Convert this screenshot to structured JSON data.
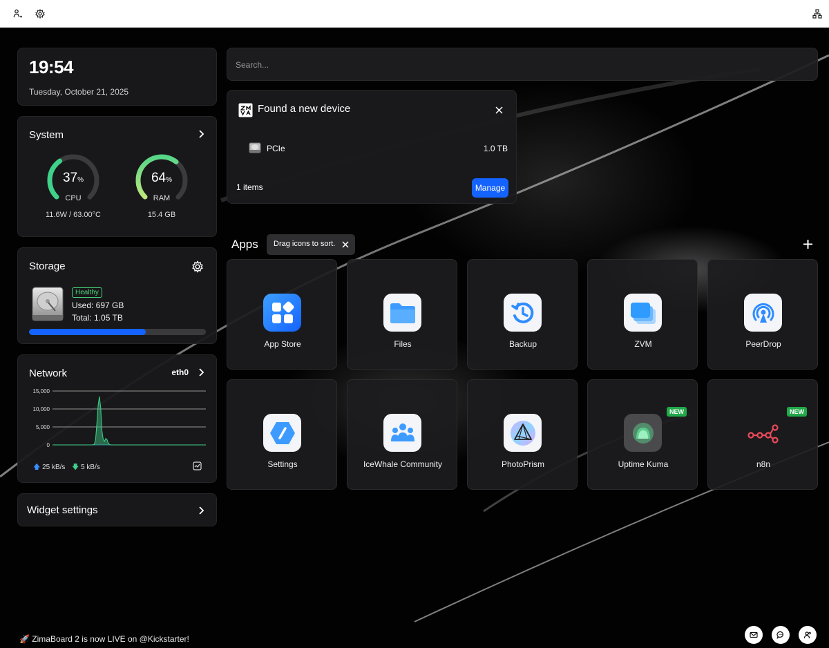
{
  "clock": {
    "time": "19:54",
    "date": "Tuesday, October 21, 2025"
  },
  "system": {
    "title": "System",
    "cpu": {
      "value": "37",
      "unit": "%",
      "label": "CPU",
      "sub": "11.6W / 63.00°C",
      "percent": 37
    },
    "ram": {
      "value": "64",
      "unit": "%",
      "label": "RAM",
      "sub": "15.4 GB",
      "percent": 64
    }
  },
  "storage": {
    "title": "Storage",
    "status": "Healthy",
    "used": "Used: 697 GB",
    "total": "Total: 1.05 TB",
    "usage_fraction": 0.66
  },
  "network": {
    "title": "Network",
    "interface": "eth0",
    "upload": "25 kB/s",
    "download": "5 kB/s",
    "chart_data": {
      "type": "area",
      "yticks": [
        "15,000",
        "10,000",
        "5,000",
        "0"
      ],
      "ylim": [
        0,
        15000
      ],
      "values": [
        0,
        0,
        0,
        0,
        0,
        0,
        0,
        0,
        0,
        0,
        0,
        0,
        0,
        0,
        0,
        0,
        0,
        0,
        0,
        0,
        0,
        0,
        0,
        0,
        0,
        0,
        0,
        0,
        0,
        0,
        0,
        0,
        40,
        200,
        1500,
        6000,
        11000,
        13500,
        10500,
        4000,
        1500,
        1000,
        1800,
        1500,
        500,
        100,
        0,
        0,
        0,
        0,
        0,
        0,
        0,
        0,
        0,
        0,
        0,
        0,
        0,
        0,
        0,
        0,
        0,
        0,
        0,
        0,
        0,
        0,
        0,
        0,
        0,
        0,
        0,
        0,
        0,
        0,
        0,
        0,
        0,
        0,
        0,
        0,
        0,
        0,
        0,
        0,
        0,
        0,
        0,
        0,
        0,
        0,
        0,
        0,
        0,
        0,
        0,
        0,
        0,
        0,
        0,
        0,
        0,
        0,
        0,
        0,
        0,
        0,
        0,
        0,
        0,
        0,
        0,
        0,
        0,
        0,
        0,
        0,
        0,
        0,
        0,
        0
      ]
    }
  },
  "widget_settings": {
    "label": "Widget settings"
  },
  "search": {
    "placeholder": "Search..."
  },
  "notification": {
    "title": "Found a new device",
    "device_name": "PCIe",
    "device_size": "1.0 TB",
    "count": "1 items",
    "manage_label": "Manage"
  },
  "apps": {
    "title": "Apps",
    "tip": "Drag icons to sort.",
    "items": [
      {
        "label": "App Store",
        "icon": "app-store-icon"
      },
      {
        "label": "Files",
        "icon": "folder-icon"
      },
      {
        "label": "Backup",
        "icon": "backup-icon"
      },
      {
        "label": "ZVM",
        "icon": "zvm-icon"
      },
      {
        "label": "PeerDrop",
        "icon": "peerdrop-icon"
      },
      {
        "label": "Settings",
        "icon": "settings-app-icon"
      },
      {
        "label": "IceWhale Community",
        "icon": "community-icon"
      },
      {
        "label": "PhotoPrism",
        "icon": "photoprism-icon"
      },
      {
        "label": "Uptime Kuma",
        "icon": "uptime-kuma-icon",
        "badge": "NEW"
      },
      {
        "label": "n8n",
        "icon": "n8n-icon",
        "badge": "NEW"
      }
    ]
  },
  "footer": {
    "announcement": "🚀 ZimaBoard 2 is now LIVE on @Kickstarter!"
  },
  "colors": {
    "accent": "#1463ff",
    "healthy": "#4ad07a",
    "new_badge": "#22a84a",
    "chart_line": "#3fd18a"
  }
}
